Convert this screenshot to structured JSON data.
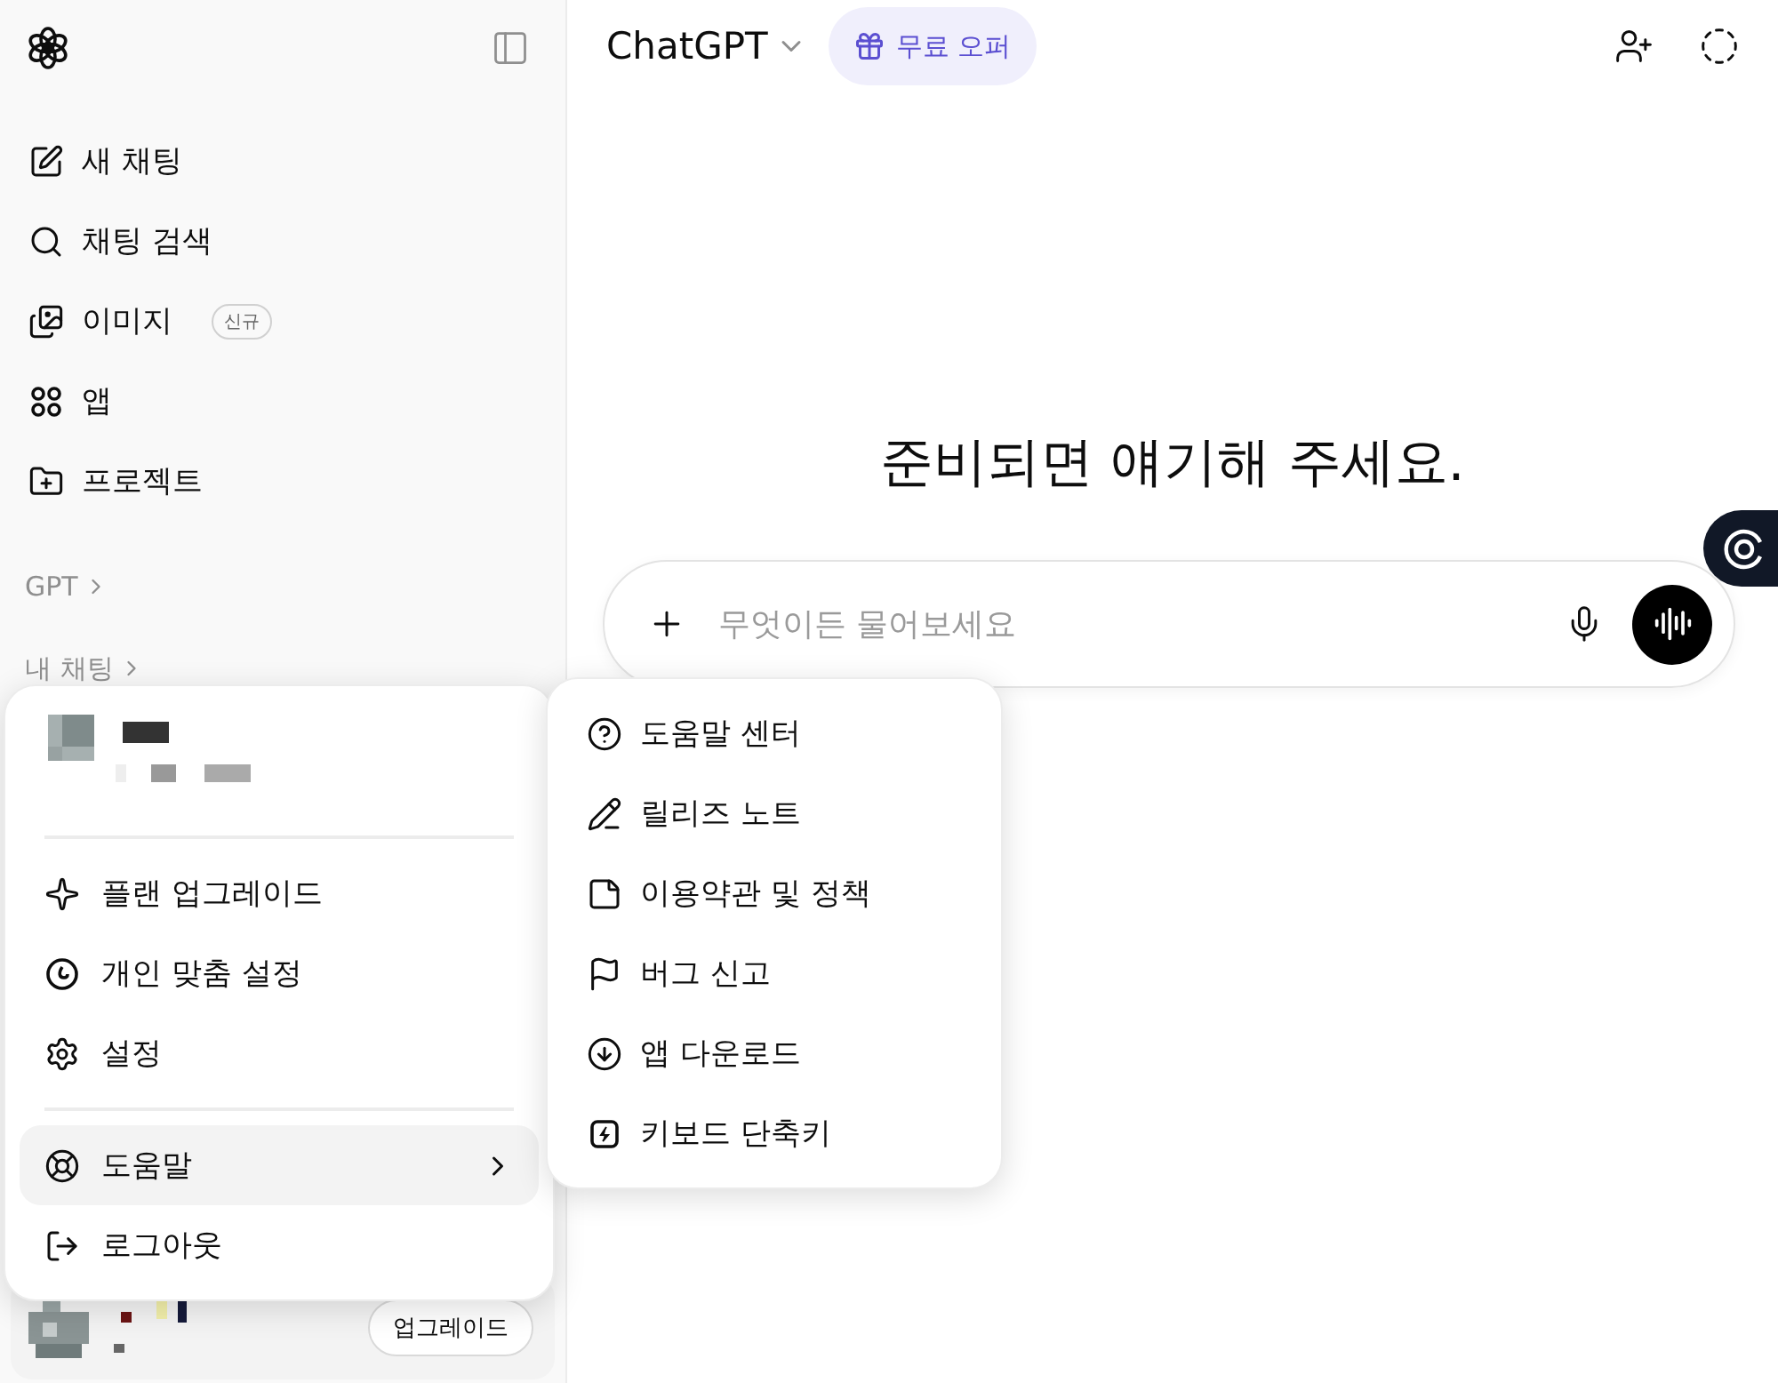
{
  "sidebar": {
    "nav": [
      {
        "label": "새 채팅"
      },
      {
        "label": "채팅 검색"
      },
      {
        "label": "이미지",
        "badge": "신규"
      },
      {
        "label": "앱"
      },
      {
        "label": "프로젝트"
      }
    ],
    "sections": [
      "GPT",
      "내 채팅"
    ],
    "upgrade_button": "업그레이드"
  },
  "header": {
    "model": "ChatGPT",
    "offer": "무료 오퍼"
  },
  "main": {
    "heading": "준비되면 얘기해 주세요.",
    "composer": {
      "placeholder": "무엇이든 물어보세요"
    }
  },
  "account_menu": {
    "sections": [
      [
        {
          "label": "플랜 업그레이드",
          "selected": false,
          "has_submenu": false
        },
        {
          "label": "개인 맞춤 설정",
          "selected": false,
          "has_submenu": false
        },
        {
          "label": "설정",
          "selected": false,
          "has_submenu": false
        }
      ],
      [
        {
          "label": "도움말",
          "selected": true,
          "has_submenu": true
        },
        {
          "label": "로그아웃",
          "selected": false,
          "has_submenu": false
        }
      ]
    ]
  },
  "help_submenu": {
    "items": [
      {
        "label": "도움말 센터"
      },
      {
        "label": "릴리즈 노트"
      },
      {
        "label": "이용약관 및 정책"
      },
      {
        "label": "버그 신고"
      },
      {
        "label": "앱 다운로드"
      },
      {
        "label": "키보드 단축키"
      }
    ]
  }
}
